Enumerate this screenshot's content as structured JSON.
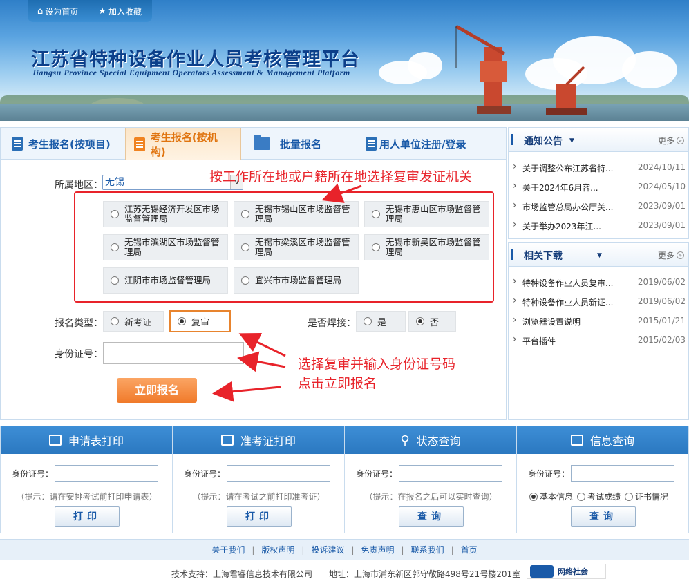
{
  "header": {
    "set_home": "设为首页",
    "add_fav": "加入收藏",
    "title_cn": "江苏省特种设备作业人员考核管理平台",
    "title_en": "Jiangsu Province Special Equipment Operators Assessment & Management Platform"
  },
  "tabs": [
    {
      "label": "考生报名(按项目)"
    },
    {
      "label": "考生报名(按机构)"
    },
    {
      "label": "批量报名"
    },
    {
      "label": "用人单位注册/登录"
    }
  ],
  "form": {
    "region_label": "所属地区：",
    "region_value": "无锡",
    "agencies": [
      "江苏无锡经济开发区市场监督管理局",
      "无锡市锡山区市场监督管理局",
      "无锡市惠山区市场监督管理局",
      "无锡市滨湖区市场监督管理局",
      "无锡市梁溪区市场监督管理局",
      "无锡市新吴区市场监督管理局",
      "江阴市市场监督管理局",
      "宜兴市市场监督管理局"
    ],
    "type_label": "报名类型：",
    "type_new": "新考证",
    "type_review": "复审",
    "weld_label": "是否焊接：",
    "weld_yes": "是",
    "weld_no": "否",
    "id_label": "身份证号：",
    "submit": "立即报名"
  },
  "annotations": {
    "top": "按工作所在地或户籍所在地选择复审发证机关",
    "line1": "选择复审并输入身份证号码",
    "line2": "点击立即报名"
  },
  "notice": {
    "title": "通知公告",
    "more": "更多",
    "items": [
      {
        "t": "关于调整公布江苏省特...",
        "d": "2024/10/11"
      },
      {
        "t": "关于2024年6月容...",
        "d": "2024/05/10"
      },
      {
        "t": "市场监管总局办公厅关...",
        "d": "2023/09/01"
      },
      {
        "t": "关于举办2023年江...",
        "d": "2023/09/01"
      }
    ]
  },
  "downloads": {
    "title": "相关下载",
    "more": "更多",
    "items": [
      {
        "t": "特种设备作业人员复审...",
        "d": "2019/06/02"
      },
      {
        "t": "特种设备作业人员新证...",
        "d": "2019/06/02"
      },
      {
        "t": "浏览器设置说明",
        "d": "2015/01/21"
      },
      {
        "t": "平台插件",
        "d": "2015/02/03"
      }
    ]
  },
  "panels": [
    {
      "title": "申请表打印",
      "label": "身份证号：",
      "hint": "（提示：请在安排考试前打印申请表）",
      "btn": "打印"
    },
    {
      "title": "准考证打印",
      "label": "身份证号：",
      "hint": "（提示：请在考试之前打印准考证）",
      "btn": "打印"
    },
    {
      "title": "状态查询",
      "label": "身份证号：",
      "hint": "（提示：在报名之后可以实时查询）",
      "btn": "查询"
    },
    {
      "title": "信息查询",
      "label": "身份证号：",
      "btn": "查询",
      "radios": [
        "基本信息",
        "考试成绩",
        "证书情况"
      ]
    }
  ],
  "footer": {
    "links": [
      "关于我们",
      "版权声明",
      "投诉建议",
      "免责声明",
      "联系我们",
      "首页"
    ],
    "support": "技术支持：上海君睿信息技术有限公司",
    "address": "地址：上海市浦东新区郭守敬路498号21号楼201室",
    "badge": "网络社会"
  }
}
